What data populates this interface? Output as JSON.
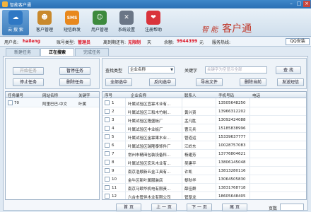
{
  "window": {
    "title": "智能客户通",
    "min": "–",
    "max": "□",
    "close": "×"
  },
  "toolbar": [
    {
      "label": "云 搜 索",
      "icon": "search-icon",
      "glyph": "☁",
      "color": "#2f78c4"
    },
    {
      "label": "客户管理",
      "icon": "user-icon",
      "glyph": "☻",
      "color": "#c9892c"
    },
    {
      "label": "短信群发",
      "icon": "sms-icon",
      "glyph": "SMS",
      "color": "#e8881d"
    },
    {
      "label": "用户管理",
      "icon": "users-icon",
      "glyph": "☺",
      "color": "#3d8a3d"
    },
    {
      "label": "系统设置",
      "icon": "tools-icon",
      "glyph": "✕",
      "color": "#6a7686"
    },
    {
      "label": "注册帮助",
      "icon": "heart-icon",
      "glyph": "❤",
      "color": "#d9333b"
    }
  ],
  "brand": {
    "part1": "智 能",
    "part2": "客户通"
  },
  "info": {
    "user_label": "用户名:",
    "user": "haileng",
    "type_label": "账号类型:",
    "type": "管理员",
    "expire_label": "离到期还有:",
    "expire": "无限制",
    "expire_unit": "天",
    "balance_label": "余额:",
    "balance": "9944399",
    "balance_unit": "元",
    "hotline_label": "服务热线:",
    "qq": "QQ安装"
  },
  "tabs": [
    "新建任务",
    "正在搜索",
    "完成任务"
  ],
  "left": {
    "start": "开始任务",
    "pause": "暂停任务",
    "stop": "停止任务",
    "delete": "删除任务",
    "headers": [
      "任务编号",
      "网站名称",
      "关键字"
    ],
    "rows": [
      {
        "id": "70",
        "site": "阿里巴巴-中文",
        "kw": "叶属"
      }
    ]
  },
  "search": {
    "type_label": "查找类型",
    "type_value": "企业名称",
    "keyword_label": "关键字",
    "keyword_placeholder": "关键字为空显示全部",
    "query": "查 找",
    "select_all": "全部选中",
    "invert": "反向选中",
    "export": "导出文件",
    "del_dup": "删除当前",
    "send_sms": "发送短信"
  },
  "grid": {
    "headers": [
      "序号",
      "企业名称",
      "联系人",
      "手机号码",
      "电话"
    ],
    "rows": [
      {
        "no": "1",
        "company": "叶属试验区宜霖木业有...",
        "contact": "",
        "mobile": "13505648250"
      },
      {
        "no": "2",
        "company": "叶属试验区三和木竹制...",
        "contact": "黄兴资",
        "mobile": "13966312202"
      },
      {
        "no": "3",
        "company": "叶属试验区隆盛板厂",
        "contact": "孟凡胜",
        "mobile": "13092424088"
      },
      {
        "no": "4",
        "company": "叶属试验区丰业板厂",
        "contact": "曹元兵",
        "mobile": "15185838996"
      },
      {
        "no": "5",
        "company": "叶属试验区金霖果木业...",
        "contact": "管道运",
        "mobile": "15339637777"
      },
      {
        "no": "6",
        "company": "叶属试验区瑞隆泰饰件厂",
        "contact": "江岭东",
        "mobile": "10028757083"
      },
      {
        "no": "7",
        "company": "常州市精田包装设备科...",
        "contact": "杨建芳",
        "mobile": "13776804621"
      },
      {
        "no": "8",
        "company": "叶属试验区宏禾木业有...",
        "contact": "吴建平",
        "mobile": "13806145048"
      },
      {
        "no": "9",
        "company": "南京浩顺新五金工具有...",
        "contact": "许凯",
        "mobile": "13813280116"
      },
      {
        "no": "10",
        "company": "金牛区新叶属服装店",
        "contact": "黎秋华",
        "mobile": "13064505830"
      },
      {
        "no": "11",
        "company": "南京马颐华机电有限责...",
        "contact": "薛佳群",
        "mobile": "13831768718"
      },
      {
        "no": "12",
        "company": "六合市管伴木业有限公司",
        "contact": "管厚龙",
        "mobile": "18605648405"
      }
    ]
  },
  "pager": {
    "first": "首 页",
    "prev": "上 一 页",
    "next": "下 一 页",
    "last": "尾 页",
    "page_label": "页数",
    "page_value": ""
  }
}
